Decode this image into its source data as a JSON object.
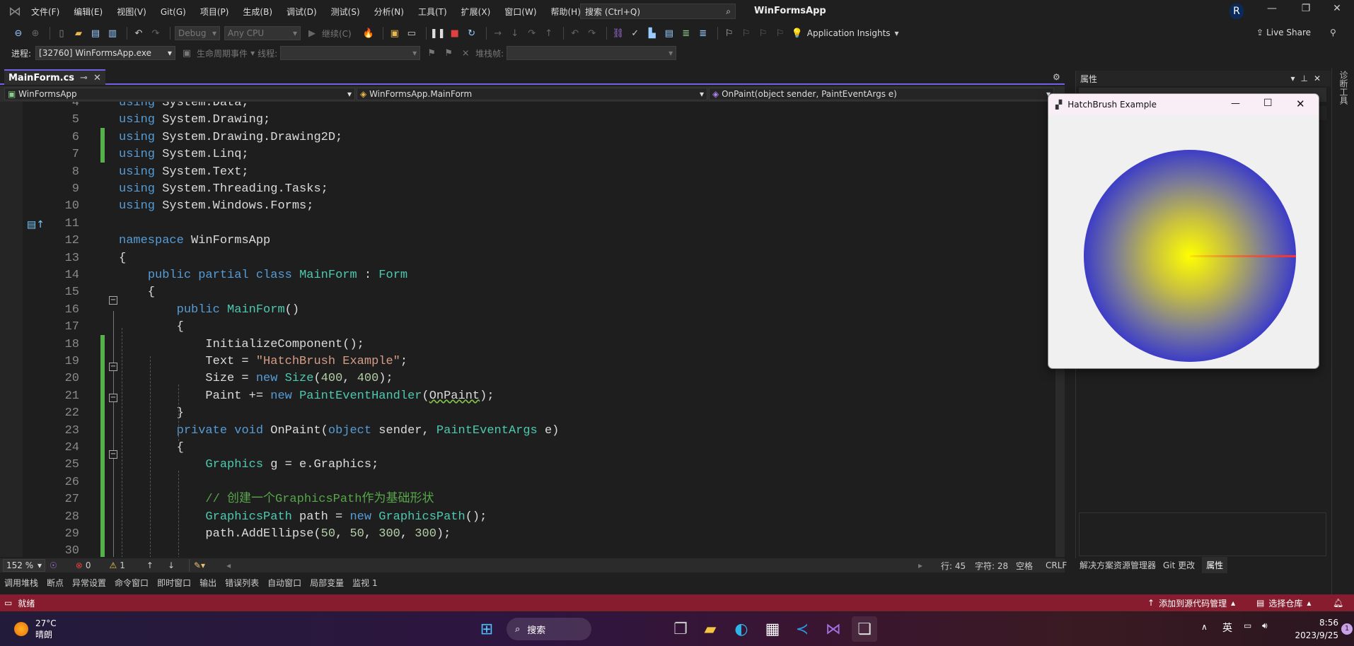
{
  "titlebar": {
    "menus": [
      "文件(F)",
      "编辑(E)",
      "视图(V)",
      "Git(G)",
      "项目(P)",
      "生成(B)",
      "调试(D)",
      "测试(S)",
      "分析(N)",
      "工具(T)",
      "扩展(X)",
      "窗口(W)",
      "帮助(H)"
    ],
    "search": "搜索 (Ctrl+Q)",
    "app_title": "WinFormsApp",
    "avatar": "R"
  },
  "toolbar": {
    "config": "Debug",
    "platform": "Any CPU",
    "continue": "继续(C)",
    "app_insights": "Application Insights",
    "live_share": "Live Share"
  },
  "debugbar": {
    "process_label": "进程:",
    "process": "[32760] WinFormsApp.exe",
    "lifecycle": "生命周期事件",
    "thread_label": "线程:",
    "stack_label": "堆栈帧:"
  },
  "tab": {
    "label": "MainForm.cs"
  },
  "nav": {
    "project": "WinFormsApp",
    "class": "WinFormsApp.MainForm",
    "member": "OnPaint(object sender, PaintEventArgs e)"
  },
  "code": {
    "lines": [
      {
        "n": "4",
        "t": [
          [
            "kw",
            "using"
          ],
          [
            "pl",
            " System.Data;"
          ]
        ]
      },
      {
        "n": "5",
        "t": [
          [
            "kw",
            "using"
          ],
          [
            "pl",
            " System.Drawing;"
          ]
        ]
      },
      {
        "n": "6",
        "t": [
          [
            "kw",
            "using"
          ],
          [
            "pl",
            " System.Drawing.Drawing2D;"
          ]
        ]
      },
      {
        "n": "7",
        "t": [
          [
            "kw",
            "using"
          ],
          [
            "pl",
            " System.Linq;"
          ]
        ]
      },
      {
        "n": "8",
        "t": [
          [
            "kw",
            "using"
          ],
          [
            "pl",
            " System.Text;"
          ]
        ]
      },
      {
        "n": "9",
        "t": [
          [
            "kw",
            "using"
          ],
          [
            "pl",
            " System.Threading.Tasks;"
          ]
        ]
      },
      {
        "n": "10",
        "t": [
          [
            "kw",
            "using"
          ],
          [
            "pl",
            " System.Windows.Forms;"
          ]
        ]
      },
      {
        "n": "11",
        "t": []
      },
      {
        "n": "12",
        "t": [
          [
            "kw",
            "namespace"
          ],
          [
            "pl",
            " WinFormsApp"
          ]
        ]
      },
      {
        "n": "13",
        "t": [
          [
            "pl",
            "{"
          ]
        ]
      },
      {
        "n": "14",
        "t": [
          [
            "pl",
            "    "
          ],
          [
            "kw",
            "public partial class"
          ],
          [
            "pl",
            " "
          ],
          [
            "ty",
            "MainForm"
          ],
          [
            "pl",
            " : "
          ],
          [
            "ty",
            "Form"
          ]
        ]
      },
      {
        "n": "15",
        "t": [
          [
            "pl",
            "    {"
          ]
        ]
      },
      {
        "n": "16",
        "t": [
          [
            "pl",
            "        "
          ],
          [
            "kw",
            "public"
          ],
          [
            "pl",
            " "
          ],
          [
            "ty",
            "MainForm"
          ],
          [
            "pl",
            "()"
          ]
        ]
      },
      {
        "n": "17",
        "t": [
          [
            "pl",
            "        {"
          ]
        ]
      },
      {
        "n": "18",
        "t": [
          [
            "pl",
            "            InitializeComponent();"
          ]
        ]
      },
      {
        "n": "19",
        "t": [
          [
            "pl",
            "            Text = "
          ],
          [
            "str",
            "\"HatchBrush Example\""
          ],
          [
            "pl",
            ";"
          ]
        ]
      },
      {
        "n": "20",
        "t": [
          [
            "pl",
            "            Size = "
          ],
          [
            "kw",
            "new"
          ],
          [
            "pl",
            " "
          ],
          [
            "ty",
            "Size"
          ],
          [
            "pl",
            "("
          ],
          [
            "num",
            "400"
          ],
          [
            "pl",
            ", "
          ],
          [
            "num",
            "400"
          ],
          [
            "pl",
            ");"
          ]
        ]
      },
      {
        "n": "21",
        "t": [
          [
            "pl",
            "            Paint += "
          ],
          [
            "kw",
            "new"
          ],
          [
            "pl",
            " "
          ],
          [
            "ty",
            "PaintEventHandler"
          ],
          [
            "pl",
            "("
          ],
          [
            "sq",
            "OnPaint"
          ],
          [
            "pl",
            ");"
          ]
        ]
      },
      {
        "n": "22",
        "t": [
          [
            "pl",
            "        }"
          ]
        ]
      },
      {
        "n": "23",
        "t": [
          [
            "pl",
            "        "
          ],
          [
            "kw",
            "private void"
          ],
          [
            "pl",
            " OnPaint("
          ],
          [
            "kw",
            "object"
          ],
          [
            "pl",
            " sender, "
          ],
          [
            "ty",
            "PaintEventArgs"
          ],
          [
            "pl",
            " e)"
          ]
        ]
      },
      {
        "n": "24",
        "t": [
          [
            "pl",
            "        {"
          ]
        ]
      },
      {
        "n": "25",
        "t": [
          [
            "pl",
            "            "
          ],
          [
            "ty",
            "Graphics"
          ],
          [
            "pl",
            " g = e.Graphics;"
          ]
        ]
      },
      {
        "n": "26",
        "t": []
      },
      {
        "n": "27",
        "t": [
          [
            "pl",
            "            "
          ],
          [
            "cm",
            "// 创建一个GraphicsPath作为基础形状"
          ]
        ]
      },
      {
        "n": "28",
        "t": [
          [
            "pl",
            "            "
          ],
          [
            "ty",
            "GraphicsPath"
          ],
          [
            "pl",
            " path = "
          ],
          [
            "kw",
            "new"
          ],
          [
            "pl",
            " "
          ],
          [
            "ty",
            "GraphicsPath"
          ],
          [
            "pl",
            "();"
          ]
        ]
      },
      {
        "n": "29",
        "t": [
          [
            "pl",
            "            path.AddEllipse("
          ],
          [
            "num",
            "50"
          ],
          [
            "pl",
            ", "
          ],
          [
            "num",
            "50"
          ],
          [
            "pl",
            ", "
          ],
          [
            "num",
            "300"
          ],
          [
            "pl",
            ", "
          ],
          [
            "num",
            "300"
          ],
          [
            "pl",
            ");"
          ]
        ]
      },
      {
        "n": "30",
        "t": []
      }
    ]
  },
  "editor_status": {
    "zoom": "152 %",
    "errors": "0",
    "warnings": "1",
    "line": "行: 45",
    "char": "字符: 28",
    "spaces": "空格",
    "eol": "CRLF"
  },
  "tool_windows": [
    "调用堆栈",
    "断点",
    "异常设置",
    "命令窗口",
    "即时窗口",
    "输出",
    "错误列表",
    "自动窗口",
    "局部变量",
    "监视 1"
  ],
  "statusbar": {
    "ready": "就绪",
    "add_source": "添加到源代码管理",
    "select_repo": "选择仓库"
  },
  "right_panel": {
    "title": "属性",
    "tabs": [
      "解决方案资源管理器",
      "Git 更改",
      "属性"
    ],
    "vertical_tab": "诊断工具"
  },
  "form": {
    "title": "HatchBrush Example",
    "center_color": "#ffff00",
    "surround_color": "#0000ff"
  },
  "taskbar": {
    "temp": "27°C",
    "weather": "晴朗",
    "search": "搜索",
    "ime": "英",
    "time": "8:56",
    "date": "2023/9/25",
    "notifications": "1"
  }
}
